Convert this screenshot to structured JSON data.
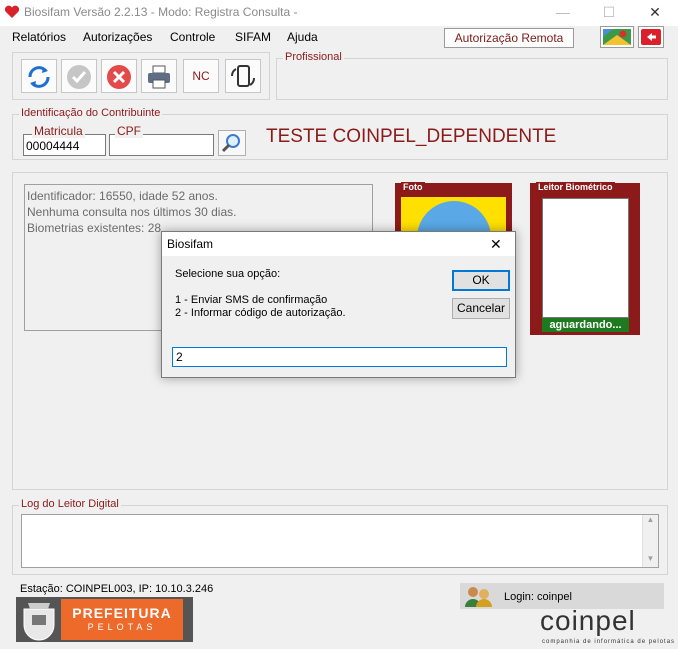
{
  "window": {
    "title": "Biosifam Versão 2.2.13 - Modo: Registra Consulta -",
    "minimize_glyph": "—",
    "maximize_glyph": "☐",
    "close_glyph": "✕"
  },
  "menu": {
    "items": [
      "Relatórios",
      "Autorizações",
      "Controle",
      "SIFAM",
      "Ajuda"
    ],
    "remote_auth_label": "Autorização Remota"
  },
  "toolbar": {
    "nc_label": "NC",
    "icons": [
      "refresh-icon",
      "confirm-icon",
      "cancel-icon",
      "print-icon",
      "nc-icon",
      "device-icon"
    ]
  },
  "profissional": {
    "title": "Profissional"
  },
  "contribuinte": {
    "title": "Identificação do Contribuinte",
    "matricula_label": "Matricula",
    "matricula_value": "00004444",
    "cpf_label": "CPF",
    "cpf_value": "",
    "name": "TESTE COINPEL_DEPENDENTE"
  },
  "info": {
    "lines": [
      "Identificador: 16550, idade 52 anos.",
      "Nenhuma consulta nos últimos 30 dias.",
      "Biometrias existentes: 28"
    ]
  },
  "foto": {
    "title": "Foto"
  },
  "leitor": {
    "title": "Leitor Biométrico",
    "status": "aguardando..."
  },
  "dialog": {
    "title": "Biosifam",
    "prompt": "Selecione sua opção:",
    "option1": "1 - Enviar SMS de confirmação",
    "option2": "2 - Informar código de autorização.",
    "input_value": "2",
    "ok_label": "OK",
    "cancel_label": "Cancelar",
    "close_glyph": "✕"
  },
  "log": {
    "title": "Log do Leitor Digital"
  },
  "status": {
    "station": "Estação: COINPEL003, IP: 10.10.3.246",
    "login": "Login: coinpel"
  },
  "branding": {
    "prefeitura_line1": "PREFEITURA",
    "prefeitura_line2": "PELOTAS",
    "coinpel_name": "coinpel",
    "coinpel_tagline": "companhia de informática de pelotas"
  },
  "colors": {
    "accent_red": "#8b1a1a",
    "photo_yellow": "#ffe000",
    "photo_blue": "#5aa9e6",
    "status_green": "#1e7a1e",
    "prefeitura_orange": "#ee6a2b",
    "coinpel_teal": "#1aa89a"
  }
}
